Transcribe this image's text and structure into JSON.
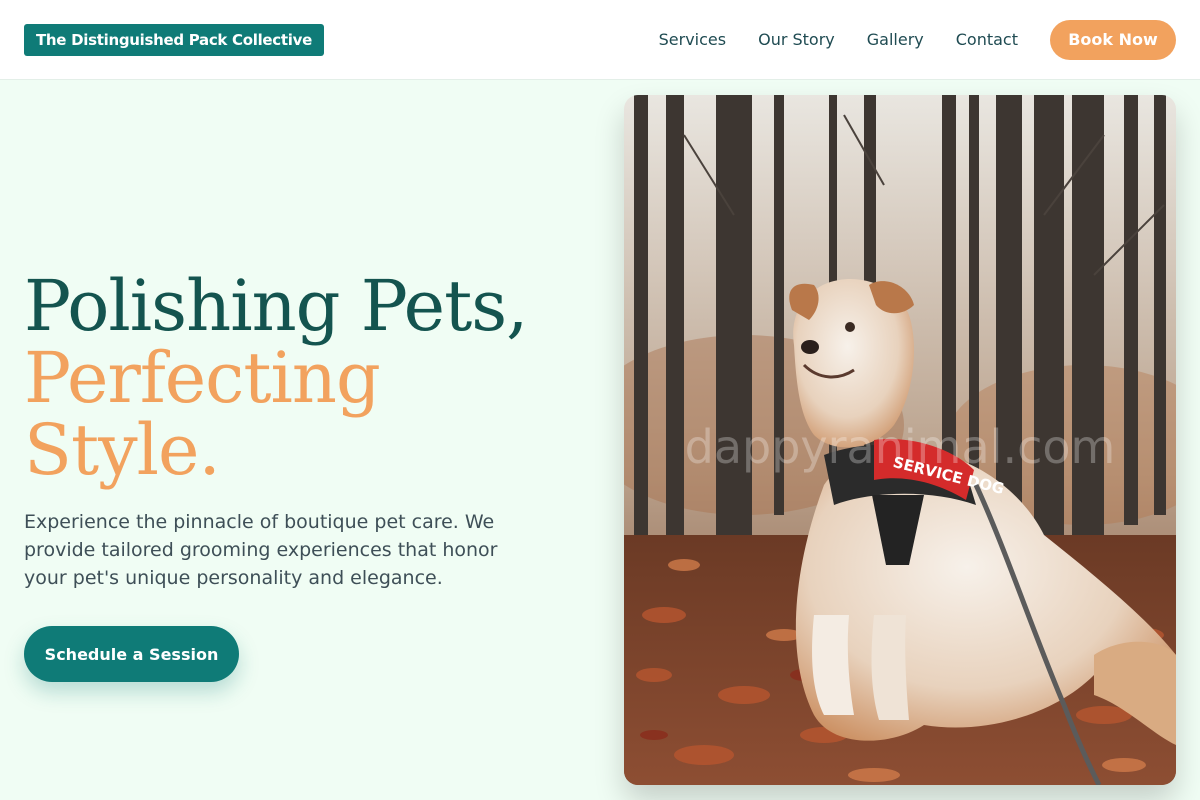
{
  "brand": {
    "name": "The Distinguished Pack Collective"
  },
  "nav": {
    "items": [
      "Services",
      "Our Story",
      "Gallery",
      "Contact"
    ],
    "cta_label": "Book Now"
  },
  "hero": {
    "headline_line1": "Polishing Pets,",
    "headline_line2": "Perfecting Style.",
    "subtext": "Experience the pinnacle of boutique pet care. We provide tailored grooming experiences that honor your pet's unique personality and elegance.",
    "cta_label": "Schedule a Session"
  },
  "image": {
    "harness_text": "SERVICE DOG",
    "watermark": "dappyranimal.com"
  },
  "colors": {
    "primary": "#0f7b77",
    "accent": "#f2a25e",
    "heading": "#14544f",
    "background": "#f0fdf4"
  }
}
